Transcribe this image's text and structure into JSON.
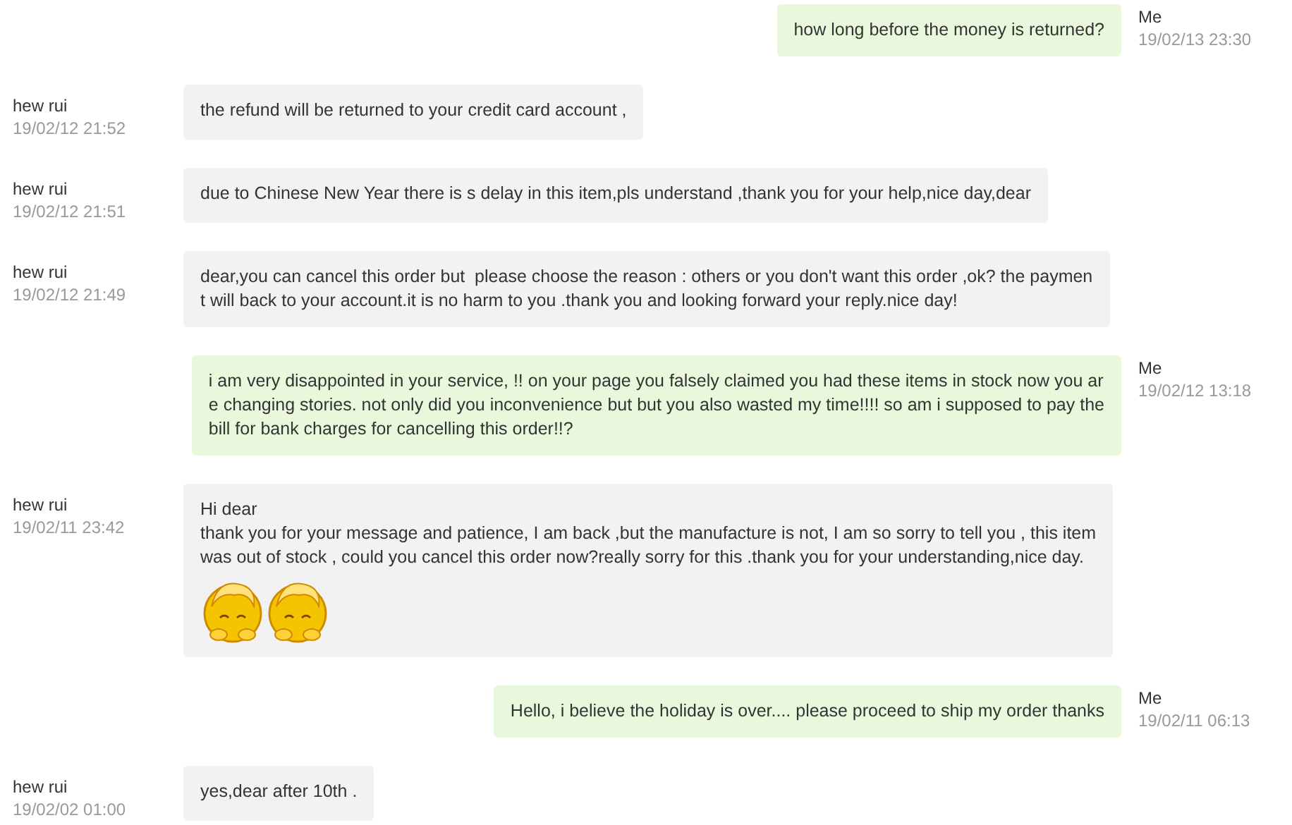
{
  "messages": [
    {
      "kind": "sent",
      "name": "Me",
      "time": "19/02/13 23:30",
      "lines": [
        "how long before the money is returned?"
      ]
    },
    {
      "kind": "received",
      "name": "hew rui",
      "time": "19/02/12 21:52",
      "lines": [
        "the refund will be returned to your credit card account ,"
      ]
    },
    {
      "kind": "received",
      "name": "hew rui",
      "time": "19/02/12 21:51",
      "lines": [
        "due to Chinese New Year there is s delay in this item,pls understand ,thank you for your help,nice day,dear"
      ]
    },
    {
      "kind": "received",
      "name": "hew rui",
      "time": "19/02/12 21:49",
      "lines": [
        "dear,you can cancel this order but  please choose the reason : others or you don't want this order ,ok? the paymen",
        "t will back to your account.it is no harm to you .thank you and looking forward your reply.nice day!"
      ]
    },
    {
      "kind": "sent",
      "name": "Me",
      "time": "19/02/12 13:18",
      "lines": [
        "i am very disappointed in your service, !! on your page you falsely claimed you had these items in stock now you ar",
        "e changing stories. not only did you inconvenience but but you also wasted my time!!!! so am i supposed to pay the",
        "bill for bank charges for cancelling this order!!?"
      ]
    },
    {
      "kind": "received",
      "name": "hew rui",
      "time": "19/02/11 23:42",
      "lines": [
        "Hi dear",
        "thank you for your message and patience, I am back ,but the manufacture is not, I am so sorry to tell you , this item",
        "was out of stock , could you cancel this order now?really sorry for this .thank you for your understanding,nice day."
      ],
      "stickers": [
        {
          "kind": "emoticon"
        },
        {
          "kind": "emoticon"
        }
      ]
    },
    {
      "kind": "sent",
      "name": "Me",
      "time": "19/02/11 06:13",
      "lines": [
        "Hello, i believe the holiday is over.... please proceed to ship my order thanks"
      ]
    },
    {
      "kind": "received",
      "name": "hew rui",
      "time": "19/02/02 01:00",
      "lines": [
        "yes,dear after 10th ."
      ]
    }
  ]
}
